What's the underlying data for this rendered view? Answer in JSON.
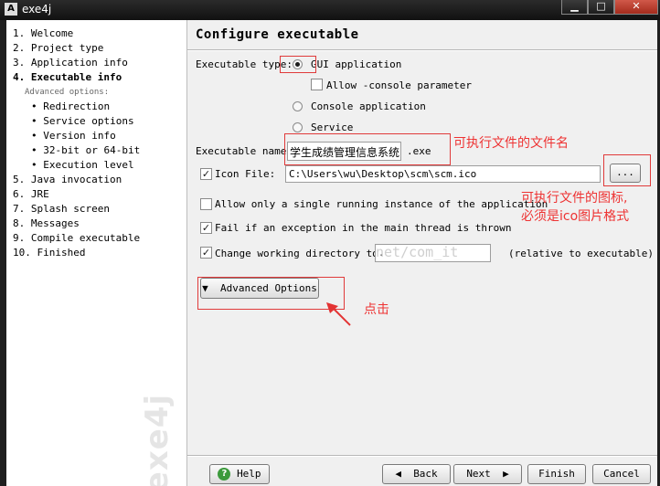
{
  "window": {
    "title": "exe4j",
    "app_icon": "A",
    "minimize": "▁",
    "maximize": "□",
    "close": "✕"
  },
  "sidebar": {
    "steps": [
      {
        "num": "1.",
        "label": "Welcome"
      },
      {
        "num": "2.",
        "label": "Project type"
      },
      {
        "num": "3.",
        "label": "Application info"
      },
      {
        "num": "4.",
        "label": "Executable info"
      },
      {
        "num": "5.",
        "label": "Java invocation"
      },
      {
        "num": "6.",
        "label": "JRE"
      },
      {
        "num": "7.",
        "label": "Splash screen"
      },
      {
        "num": "8.",
        "label": "Messages"
      },
      {
        "num": "9.",
        "label": "Compile executable"
      },
      {
        "num": "10.",
        "label": "Finished"
      }
    ],
    "advanced_label": "Advanced options:",
    "substeps": [
      "Redirection",
      "Service options",
      "Version info",
      "32-bit or 64-bit",
      "Execution level"
    ],
    "logo_text": "exe4j"
  },
  "main": {
    "heading": "Configure executable",
    "exe_type_label": "Executable type:",
    "types": {
      "gui": "GUI application",
      "allow_console": "Allow -console parameter",
      "console": "Console application",
      "service": "Service"
    },
    "exe_name_label": "Executable name:",
    "exe_name_value": "学生成绩管理信息系统",
    "exe_suffix": ".exe",
    "icon_file_label": "Icon File:",
    "icon_file_value": "C:\\Users\\wu\\Desktop\\scm\\scm.ico",
    "browse_label": "...",
    "single_instance_label": "Allow only a single running instance of the application",
    "fail_exception_label": "Fail if an exception in the main thread is thrown",
    "change_dir_label": "Change working directory to:",
    "change_dir_value": ".",
    "relative_label": "(relative to executable)",
    "advanced_options_label": "Advanced Options",
    "states": {
      "gui": true,
      "allow_console": false,
      "icon_file": true,
      "single_instance": false,
      "fail_exception": true,
      "change_dir": true
    }
  },
  "annotations": {
    "exe_name_note": "可执行文件的文件名",
    "icon_note_line1": "可执行文件的图标,",
    "icon_note_line2": "必须是ico图片格式",
    "click_note": "点击",
    "color": "#e33333"
  },
  "watermark": "net/com_it",
  "footer": {
    "help": "Help",
    "back": "Back",
    "next": "Next",
    "finish": "Finish",
    "cancel": "Cancel"
  }
}
